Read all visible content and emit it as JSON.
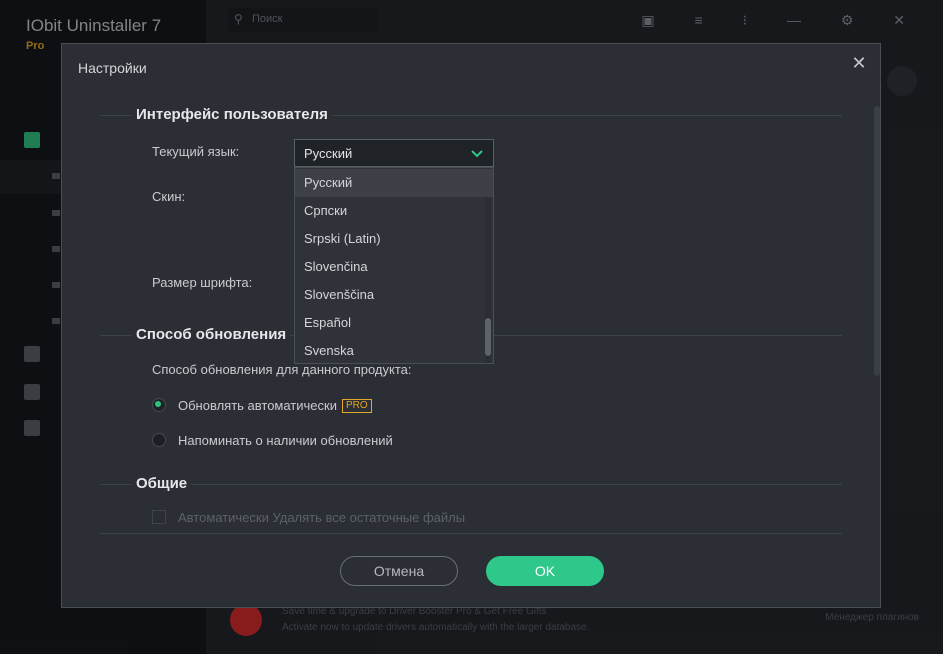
{
  "background_app": {
    "title": "IObit Uninstaller 7",
    "edition": "Pro",
    "search_placeholder": "Поиск",
    "promo_line1": "Save time & upgrade to Driver Booster Pro & Get Free Gifts",
    "promo_line2": "Activate now to update drivers automatically with the larger database.",
    "promo_right": "Менеджер плагинов"
  },
  "dialog": {
    "title": "Настройки",
    "close_glyph": "✕",
    "sections": {
      "interface": {
        "title": "Интерфейс пользователя",
        "language_label": "Текущий язык:",
        "skin_label": "Скин:",
        "font_size_label": "Размер шрифта:",
        "language_select": {
          "value": "Русский",
          "options": [
            "Русский",
            "Српски",
            "Srpski (Latin)",
            "Slovenčina",
            "Slovenščina",
            "Español",
            "Svenska"
          ],
          "selected_index": 0
        }
      },
      "update": {
        "title": "Способ обновления",
        "description": "Способ обновления для данного продукта:",
        "options": [
          {
            "label": "Обновлять автоматически",
            "checked": true,
            "badge": "PRO"
          },
          {
            "label": "Напоминать о наличии обновлений",
            "checked": false
          }
        ]
      },
      "general": {
        "title": "Общие",
        "auto_delete_label": "Автоматически Удалять все остаточные файлы"
      }
    },
    "buttons": {
      "cancel": "Отмена",
      "ok": "OK"
    }
  },
  "colors": {
    "accent": "#2ec88a",
    "pro_badge": "#e3a72a",
    "dialog_bg": "#2b2e34"
  }
}
